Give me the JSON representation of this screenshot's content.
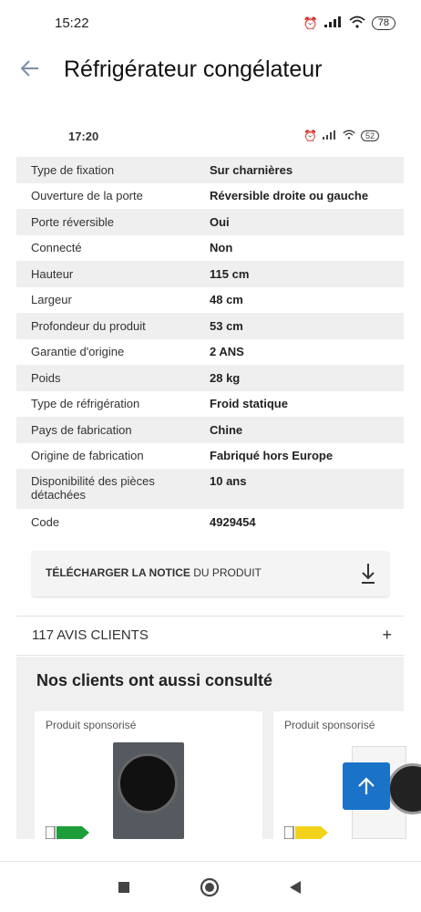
{
  "status_bar": {
    "time": "15:22",
    "signal": "..ıll",
    "battery": "78"
  },
  "header": {
    "title": "Réfrigérateur congélateur"
  },
  "embedded_status": {
    "time": "17:20",
    "battery": "52"
  },
  "specs": [
    {
      "key": "Type de fixation",
      "value": "Sur charnières"
    },
    {
      "key": "Ouverture de la porte",
      "value": "Réversible droite ou gauche"
    },
    {
      "key": "Porte réversible",
      "value": "Oui"
    },
    {
      "key": "Connecté",
      "value": "Non"
    },
    {
      "key": "Hauteur",
      "value": "115 cm"
    },
    {
      "key": "Largeur",
      "value": "48 cm"
    },
    {
      "key": "Profondeur du produit",
      "value": "53 cm"
    },
    {
      "key": "Garantie d'origine",
      "value": "2 ANS"
    },
    {
      "key": "Poids",
      "value": "28 kg"
    },
    {
      "key": "Type de réfrigération",
      "value": "Froid statique"
    },
    {
      "key": "Pays de fabrication",
      "value": "Chine"
    },
    {
      "key": "Origine de fabrication",
      "value": "Fabriqué hors Europe"
    },
    {
      "key": "Disponibilité des pièces détachées",
      "value": "10 ans"
    },
    {
      "key": "Code",
      "value": "4929454"
    }
  ],
  "download": {
    "bold": "TÉLÉCHARGER LA NOTICE",
    "rest": " DU PRODUIT"
  },
  "reviews": {
    "label": "117 AVIS CLIENTS",
    "toggle": "+"
  },
  "consulted": {
    "title": "Nos clients ont aussi consulté",
    "cards": [
      {
        "label": "Produit sponsorisé"
      },
      {
        "label": "Produit sponsorisé"
      }
    ]
  },
  "colors": {
    "accent_blue": "#1a73c9",
    "row_gray": "#efefef",
    "red": "#e02020"
  }
}
